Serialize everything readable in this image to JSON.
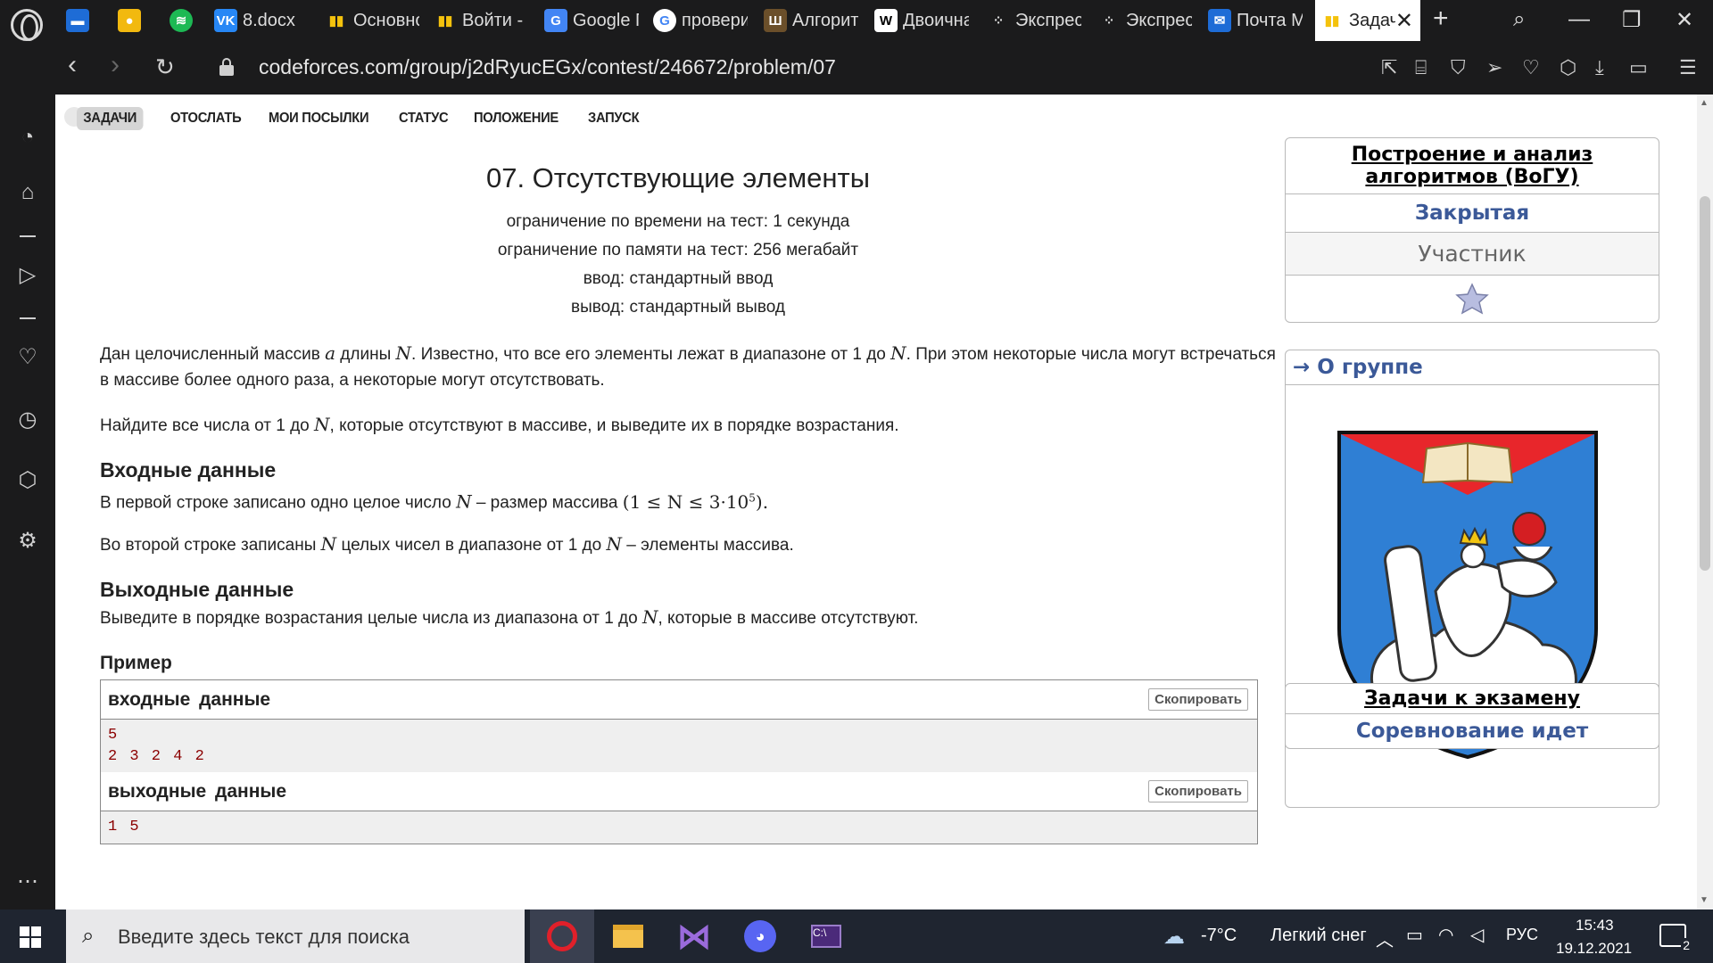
{
  "browser": {
    "tabs": [
      {
        "label": "",
        "icon": "chat-icon",
        "color": "#1e6cd6"
      },
      {
        "label": "",
        "icon": "bulb-icon",
        "color": "#f2b90f"
      },
      {
        "label": "",
        "icon": "spotify-icon",
        "color": "#1db954"
      },
      {
        "label": "8.docx",
        "icon": "vk-icon",
        "color": "#2787f5"
      },
      {
        "label": "Основно",
        "icon": "chart-icon",
        "color": "#3b5998"
      },
      {
        "label": "Войти - (",
        "icon": "chart-icon",
        "color": "#3b5998"
      },
      {
        "label": "Google П",
        "icon": "translate-icon",
        "color": "#4285f4"
      },
      {
        "label": "провери",
        "icon": "google-icon",
        "color": "#ffffff"
      },
      {
        "label": "Алгоритм",
        "icon": "book-icon",
        "color": "#6b4f2a"
      },
      {
        "label": "Двоична",
        "icon": "wikipedia-icon",
        "color": "#ffffff"
      },
      {
        "label": "Экспрес",
        "icon": "grid-icon",
        "color": "#dddddd"
      },
      {
        "label": "Экспрес",
        "icon": "grid-icon",
        "color": "#dddddd"
      },
      {
        "label": "Почта M",
        "icon": "mail-icon",
        "color": "#1e6cd6"
      },
      {
        "label": "Задач",
        "icon": "chart-icon",
        "color": "#3b5998"
      }
    ],
    "url": "codeforces.com/group/j2dRyucEGx/contest/246672/problem/07"
  },
  "menu": [
    "ЗАДАЧИ",
    "ОТОСЛАТЬ",
    "МОИ ПОСЫЛКИ",
    "СТАТУС",
    "ПОЛОЖЕНИЕ",
    "ЗАПУСК"
  ],
  "problem": {
    "title": "07. Отсутствующие элементы",
    "time_limit": "ограничение по времени на тест: 1 секунда",
    "memory_limit": "ограничение по памяти на тест: 256 мегабайт",
    "input": "ввод: стандартный ввод",
    "output": "вывод: стандартный вывод",
    "statement_1a": "Дан целочисленный массив ",
    "var_a": "a",
    "statement_1b": " длины ",
    "var_N": "N",
    "statement_1c": ". Известно, что все его элементы лежат в диапазоне от 1 до ",
    "statement_1d": ". При этом некоторые числа могут встречаться в массиве более одного раза, а некоторые могут отсутствовать.",
    "statement_2a": "Найдите все числа от 1 до ",
    "statement_2b": ", которые отсутствуют в массиве, и выведите их в порядке возрастания.",
    "input_title": "Входные данные",
    "input_1a": "В первой строке записано одно целое число ",
    "input_1b": " – размер массива ",
    "constraint": "(1 ≤ N ≤ 3·10",
    "constraint_exp": "5",
    "constraint_end": ").",
    "input_2a": "Во второй строке записаны ",
    "input_2b": " целых чисел в диапазоне от 1 до ",
    "input_2c": " – элементы массива.",
    "output_title": "Выходные данные",
    "output_1a": "Выведите в порядке возрастания целые числа из диапазона от 1 до ",
    "output_1b": ", которые в массиве отсутствуют.",
    "example_title": "Пример",
    "sample_input_title": "входные данные",
    "sample_output_title": "выходные данные",
    "copy_label": "Скопировать",
    "sample_input_line1": "5",
    "sample_input_line2": "2 3 2 4 2",
    "sample_output_line1": "1 5"
  },
  "right": {
    "group_title": "Построение и анализ алгоритмов (ВоГУ)",
    "group_status": "Закрытая",
    "group_role": "Участник",
    "about": "→ О группе",
    "exam_title": "Задачи к экзамену",
    "exam_status": "Соревнование идет"
  },
  "taskbar": {
    "search_placeholder": "Введите здесь текст для поиска",
    "weather_temp": "-7°C",
    "weather_desc": "Легкий снег",
    "lang": "РУС",
    "time": "15:43",
    "date": "19.12.2021",
    "notifications": "2"
  }
}
